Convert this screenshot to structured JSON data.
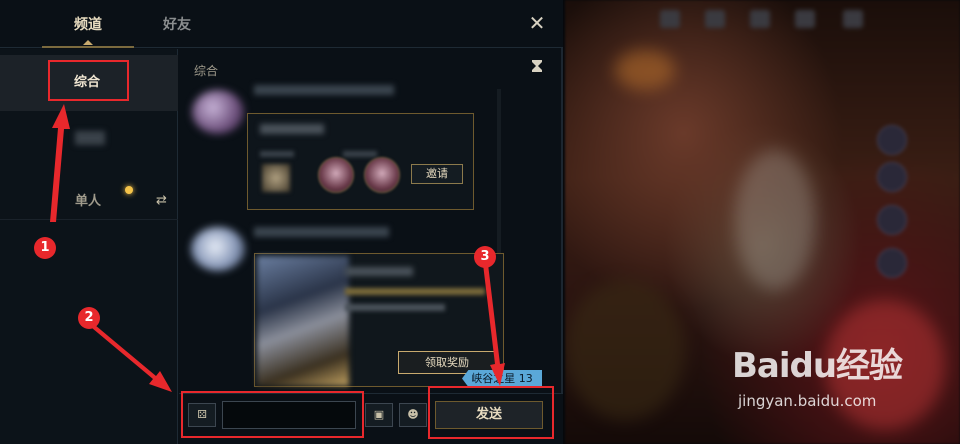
{
  "header": {
    "tabs": [
      {
        "label": "频道",
        "active": true
      },
      {
        "label": "好友",
        "active": false
      }
    ],
    "close_symbol": "✕"
  },
  "sidebar": {
    "items": [
      {
        "label": "综合",
        "selected": true
      },
      {
        "label": "单人",
        "selected": false
      }
    ],
    "swap_symbol": "⇄"
  },
  "chat": {
    "channel_name": "综合",
    "invite_card": {
      "button_label": "邀请"
    },
    "reward_card": {
      "button_label": "领取奖励"
    },
    "rift_badge": "峡谷之星 13"
  },
  "input_bar": {
    "input_value": "",
    "send_label": "发送"
  },
  "annotations": {
    "markers": [
      "1",
      "2",
      "3"
    ],
    "color": "#e8282c"
  },
  "watermark": {
    "logo": "Baidu经验",
    "url": "jingyan.baidu.com"
  },
  "colors": {
    "gold": "#c8aa6e",
    "panel_bg": "#0a1016",
    "badge": "#5aa8d8"
  },
  "icons": [
    "close-icon",
    "swap-icon",
    "hourglass-icon",
    "dice-icon",
    "photo-icon",
    "smile-icon",
    "status-dot-icon"
  ]
}
